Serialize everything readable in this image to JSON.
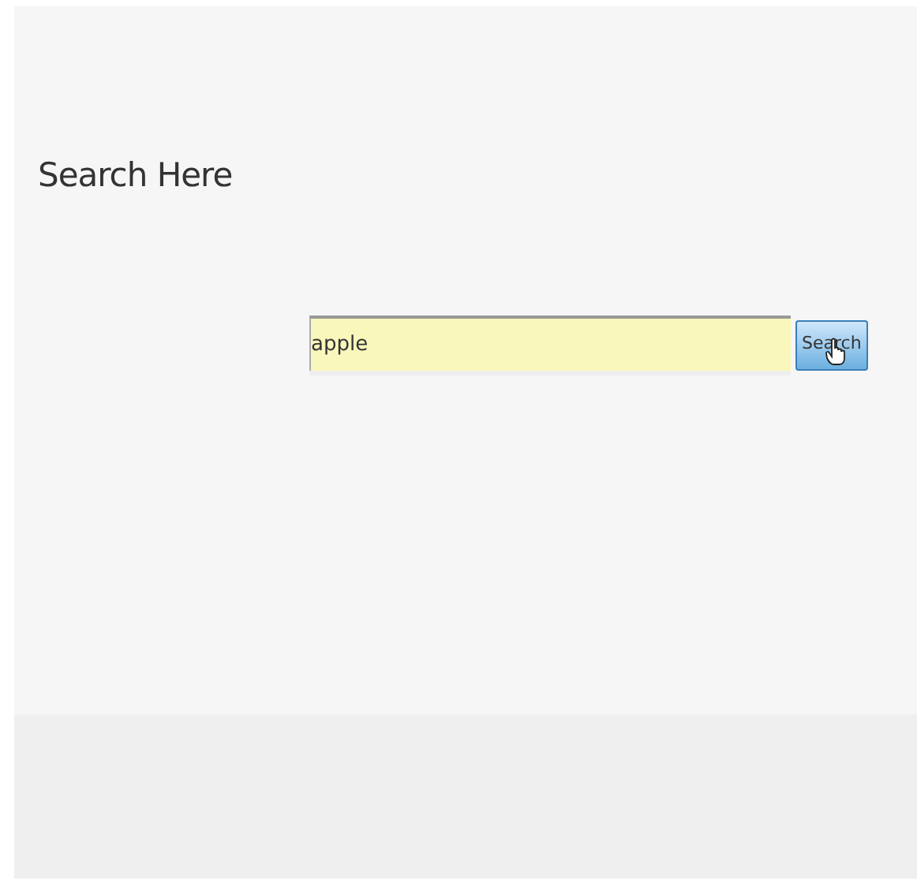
{
  "heading": "Search Here",
  "search": {
    "value": "apple",
    "button": "Search"
  }
}
